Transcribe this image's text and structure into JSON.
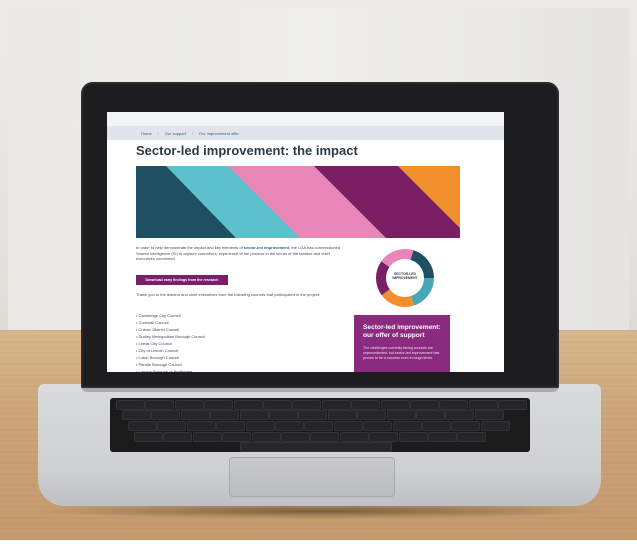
{
  "website": {
    "breadcrumb": [
      "Home",
      "Our support",
      "Our improvement offer"
    ],
    "breadcrumb_separator": "/",
    "page_title": "Sector-led improvement: the impact",
    "intro_part1": "In order to help demonstrate the impact and key elements of ",
    "intro_link": "sector-led improvement",
    "intro_part2": ", the LGA has commissioned Shared Intelligence (SI) to capture councillors' experience of the process in the words of the leaders and chief executives concerned.",
    "download_button": "Download early findings from the research",
    "thanks_text": "Thank you to the leaders and chief executives from the following councils that participated in the project:",
    "councils": [
      "Cambridge City Council",
      "Cornwall Council",
      "Craven District Council",
      "Dudley Metropolitan Borough Council",
      "Leeds City Council",
      "City of Lincoln Council",
      "Luton Borough Council",
      "Pendle Borough Council",
      "London Borough of Redbridge"
    ],
    "logo_text": "SECTOR-LED IMPROVEMENT",
    "offer_title": "Sector-led improvement: our offer of support",
    "offer_text": "The challenges currently facing councils are unprecedented, but sector-led improvement has proven to be a success even in tough times."
  },
  "colors": {
    "banner": [
      "#1f4f63",
      "#5cc1ca",
      "#e987b9",
      "#7a1f63",
      "#f08f2b"
    ],
    "button": "#7a1f6a",
    "offer_panel": "#8a2b7f",
    "laptop_bezel": "#1d1d1f",
    "laptop_body": "#cfd0d2",
    "desk": "#cda67a"
  }
}
